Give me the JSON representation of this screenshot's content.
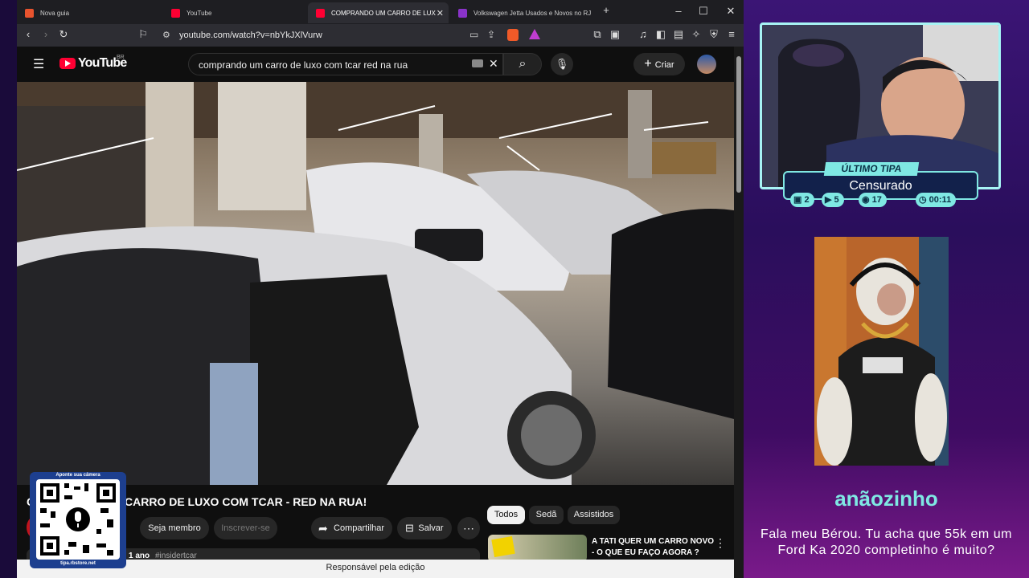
{
  "browser": {
    "tabs": [
      {
        "label": "Nova guia",
        "active": false
      },
      {
        "label": "YouTube",
        "active": false
      },
      {
        "label": "COMPRANDO UM CARRO DE LUXO CO",
        "active": true
      },
      {
        "label": "Volkswagen Jetta Usados e Novos no RJ",
        "active": false
      }
    ],
    "new_tab": "+",
    "url": "youtube.com/watch?v=nbYkJXlVurw",
    "status": "Responsável pela edição"
  },
  "youtube": {
    "logo": "YouTube",
    "region": "BR",
    "search_query": "comprando um carro de luxo com tcar red na rua",
    "create_label": "Criar",
    "video_title": "CARRO DE LUXO COM TCAR - RED NA RUA!",
    "join_label": "Seja membro",
    "subscribe_label": "Inscrever-se",
    "share_label": "Compartilhar",
    "save_label": "Salvar",
    "meta_fragment": "1 ano",
    "hashtag": "#insidertcar",
    "chips": [
      "Todos",
      "Sedã",
      "Assistidos"
    ],
    "recommended": {
      "title_line1": "A TATI QUER UM CARRO NOVO",
      "title_line2": "- O QUE EU FAÇO AGORA ?"
    }
  },
  "qr_overlay": {
    "top_text": "Aponte sua câmera",
    "bottom_text": "tipa.rbstore.net"
  },
  "stream": {
    "last_tip_label": "ÚLTIMO TIPA",
    "last_tip_name": "Censurado",
    "stats": [
      {
        "icon": "chat-icon",
        "value": "2"
      },
      {
        "icon": "video-icon",
        "value": "5"
      },
      {
        "icon": "tipa-icon",
        "value": "17"
      },
      {
        "icon": "clock-icon",
        "value": "00:11"
      }
    ],
    "streamer_name": "anãozinho",
    "message": "Fala meu Bérou. Tu acha que 55k em um Ford Ka 2020 completinho é muito?"
  },
  "colors": {
    "accent_cyan": "#7fe8e3",
    "youtube_red": "#ff0033",
    "browser_bg": "#1e1e22",
    "overlay_purple": "#3b1575"
  }
}
